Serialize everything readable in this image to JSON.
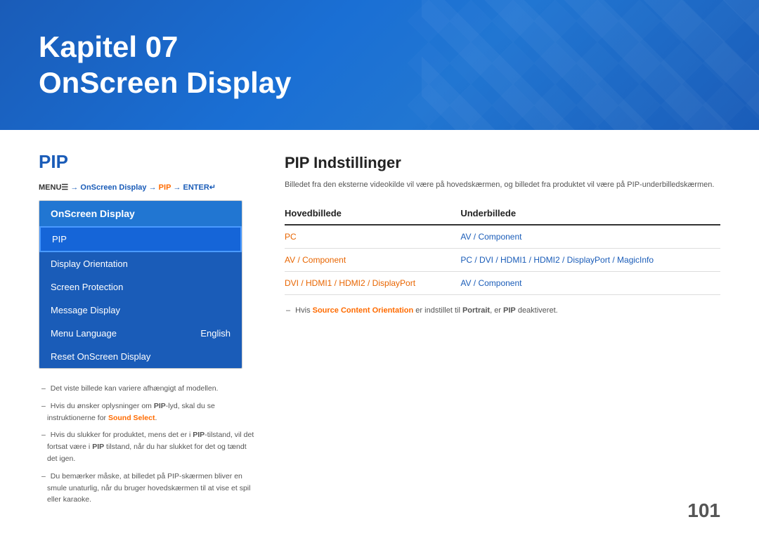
{
  "header": {
    "chapter": "Kapitel 07",
    "title": "OnScreen Display",
    "background_color": "#1a5cb8"
  },
  "left": {
    "section_title": "PIP",
    "menu_path": {
      "prefix": "MENU",
      "menu_icon": "☰",
      "arrow1": " → ",
      "onscreen": "OnScreen Display",
      "arrow2": " → ",
      "pip_link": "PIP",
      "arrow3": " → ",
      "enter": "ENTER"
    },
    "menu_header": "OnScreen Display",
    "menu_items": [
      {
        "label": "PIP",
        "value": "",
        "active": true
      },
      {
        "label": "Display Orientation",
        "value": "",
        "active": false
      },
      {
        "label": "Screen Protection",
        "value": "",
        "active": false
      },
      {
        "label": "Message Display",
        "value": "",
        "active": false
      },
      {
        "label": "Menu Language",
        "value": "English",
        "active": false
      },
      {
        "label": "Reset OnScreen Display",
        "value": "",
        "active": false
      }
    ],
    "notes": [
      {
        "text_parts": [
          {
            "text": "Det viste billede kan variere afhængigt af modellen.",
            "bold": false,
            "orange": false
          }
        ]
      },
      {
        "text_parts": [
          {
            "text": "Hvis du ønsker oplysninger om ",
            "bold": false,
            "orange": false
          },
          {
            "text": "PIP",
            "bold": true,
            "orange": false
          },
          {
            "text": "-lyd, skal du se instruktionerne for ",
            "bold": false,
            "orange": false
          },
          {
            "text": "Sound Select",
            "bold": true,
            "orange": true
          },
          {
            "text": ".",
            "bold": false,
            "orange": false
          }
        ]
      },
      {
        "text_parts": [
          {
            "text": "Hvis du slukker for produktet, mens det er i ",
            "bold": false,
            "orange": false
          },
          {
            "text": "PIP",
            "bold": true,
            "orange": false
          },
          {
            "text": "-tilstand, vil det fortsat være i ",
            "bold": false,
            "orange": false
          },
          {
            "text": "PIP",
            "bold": true,
            "orange": false
          },
          {
            "text": " tilstand, når du har slukket for det og tændt det igen.",
            "bold": false,
            "orange": false
          }
        ]
      },
      {
        "text_parts": [
          {
            "text": "Du bemærker måske, at billedet på PIP-skærmen bliver en smule unaturlig, når du bruger hovedskærmen til at vise et spil eller karaoke.",
            "bold": false,
            "orange": false
          }
        ]
      }
    ]
  },
  "right": {
    "section_title": "PIP Indstillinger",
    "description": "Billedet fra den eksterne videokilde vil være på hovedskærmen, og billedet fra produktet vil være på PIP-underbilledskærmen.",
    "table": {
      "columns": [
        "Hovedbillede",
        "Underbillede"
      ],
      "rows": [
        {
          "col1": "PC",
          "col2": "AV / Component",
          "col1_style": "orange",
          "col2_style": "blue"
        },
        {
          "col1": "AV / Component",
          "col2": "PC / DVI / HDMI1 / HDMI2 / DisplayPort / MagicInfo",
          "col1_style": "orange",
          "col2_style": "blue"
        },
        {
          "col1": "DVI / HDMI1 / HDMI2 / DisplayPort",
          "col2": "AV / Component",
          "col1_style": "orange",
          "col2_style": "blue"
        }
      ]
    },
    "table_note_parts": [
      {
        "text": "Hvis ",
        "bold": false,
        "orange": false
      },
      {
        "text": "Source Content Orientation",
        "bold": true,
        "orange": true
      },
      {
        "text": " er indstillet til ",
        "bold": false,
        "orange": false
      },
      {
        "text": "Portrait",
        "bold": true,
        "orange": false
      },
      {
        "text": ", er ",
        "bold": false,
        "orange": false
      },
      {
        "text": "PIP",
        "bold": true,
        "orange": false
      },
      {
        "text": " deaktiveret.",
        "bold": false,
        "orange": false
      }
    ]
  },
  "page_number": "101"
}
